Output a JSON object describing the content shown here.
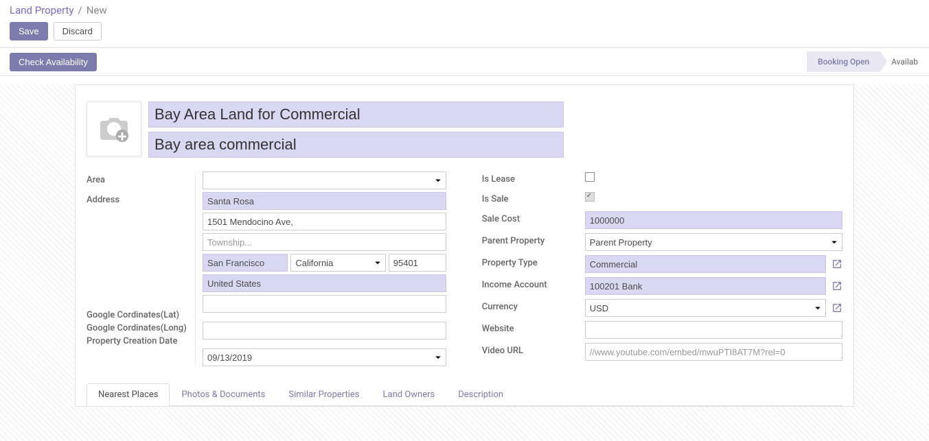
{
  "breadcrumb": {
    "parent": "Land Property",
    "current": "New"
  },
  "buttons": {
    "save": "Save",
    "discard": "Discard",
    "check_availability": "Check Availability"
  },
  "status": {
    "booking_open": "Booking Open",
    "available": "Availab"
  },
  "header": {
    "name_value": "Bay Area Land for Commercial",
    "subtitle_value": "Bay area commercial"
  },
  "left": {
    "area_label": "Area",
    "address_label": "Address",
    "street": "Santa Rosa",
    "street2": "1501 Mendocino Ave,",
    "township_placeholder": "Township...",
    "city": "San Francisco",
    "state": "California",
    "zip": "95401",
    "country": "United States",
    "glat_label": "Google Cordinates(Lat)",
    "glong_label": "Google Cordinates(Long)",
    "creation_label": "Property Creation Date",
    "creation_date": "09/13/2019"
  },
  "right": {
    "is_lease_label": "Is Lease",
    "is_sale_label": "Is Sale",
    "sale_cost_label": "Sale Cost",
    "sale_cost": "1000000",
    "parent_label": "Parent Property",
    "parent_placeholder": "Parent Property",
    "type_label": "Property Type",
    "type_value": "Commercial",
    "income_label": "Income Account",
    "income_value": "100201 Bank",
    "currency_label": "Currency",
    "currency_value": "USD",
    "website_label": "Website",
    "video_label": "Video URL",
    "video_placeholder": "//www.youtube.com/embed/mwuPTI8AT7M?rel=0"
  },
  "tabs": {
    "nearest": "Nearest Places",
    "photos": "Photos & Documents",
    "similar": "Similar Properties",
    "owners": "Land Owners",
    "description": "Description"
  }
}
